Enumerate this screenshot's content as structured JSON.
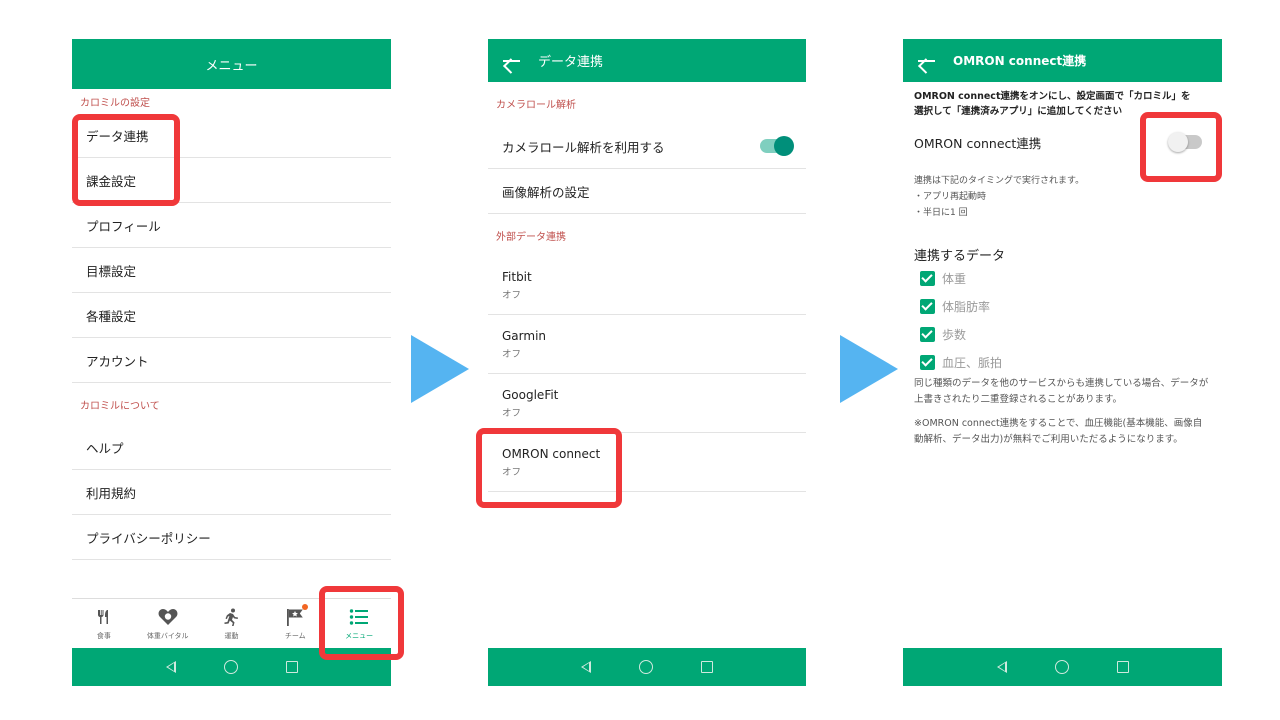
{
  "screen1": {
    "title": "メニュー",
    "section1": "カロミルの設定",
    "items1": [
      "データ連携",
      "課金設定",
      "プロフィール",
      "目標設定",
      "各種設定",
      "アカウント"
    ],
    "section2": "カロミルについて",
    "items2": [
      "ヘルプ",
      "利用規約",
      "プライバシーポリシー"
    ],
    "tabs": [
      {
        "label": "食事",
        "icon": "fork-knife-icon"
      },
      {
        "label": "体重バイタル",
        "icon": "heart-scale-icon"
      },
      {
        "label": "運動",
        "icon": "running-icon"
      },
      {
        "label": "チーム",
        "icon": "flag-star-icon"
      },
      {
        "label": "メニュー",
        "icon": "list-icon"
      }
    ]
  },
  "screen2": {
    "title": "データ連携",
    "section1": "カメラロール解析",
    "camera_toggle_label": "カメラロール解析を利用する",
    "camera_toggle_on": true,
    "image_settings": "画像解析の設定",
    "section2": "外部データ連携",
    "services": [
      {
        "name": "Fitbit",
        "status": "オフ"
      },
      {
        "name": "Garmin",
        "status": "オフ"
      },
      {
        "name": "GoogleFit",
        "status": "オフ"
      },
      {
        "name": "OMRON connect",
        "status": "オフ"
      }
    ]
  },
  "screen3": {
    "title": "OMRON connect連携",
    "intro_line1": "OMRON connect連携をオンにし、設定画面で「カロミル」を",
    "intro_line2": "選択して「連携済みアプリ」に追加してください",
    "toggle_label": "OMRON connect連携",
    "toggle_on": false,
    "timing": [
      "連携は下記のタイミングで実行されます。",
      "・アプリ再起動時",
      "・半日に1 回"
    ],
    "data_heading": "連携するデータ",
    "data_items": [
      "体重",
      "体脂肪率",
      "歩数",
      "血圧、脈拍"
    ],
    "note1": "同じ種類のデータを他のサービスからも連携している場合、データが上書きされたり二重登録されることがあります。",
    "note2": "※OMRON connect連携をすることで、血圧機能(基本機能、画像自動解析、データ出力)が無料でご利用いただるようになります。"
  },
  "colors": {
    "brand": "#00a775",
    "highlight": "#f0383a",
    "arrow": "#55b4f1",
    "section": "#c0504d"
  }
}
